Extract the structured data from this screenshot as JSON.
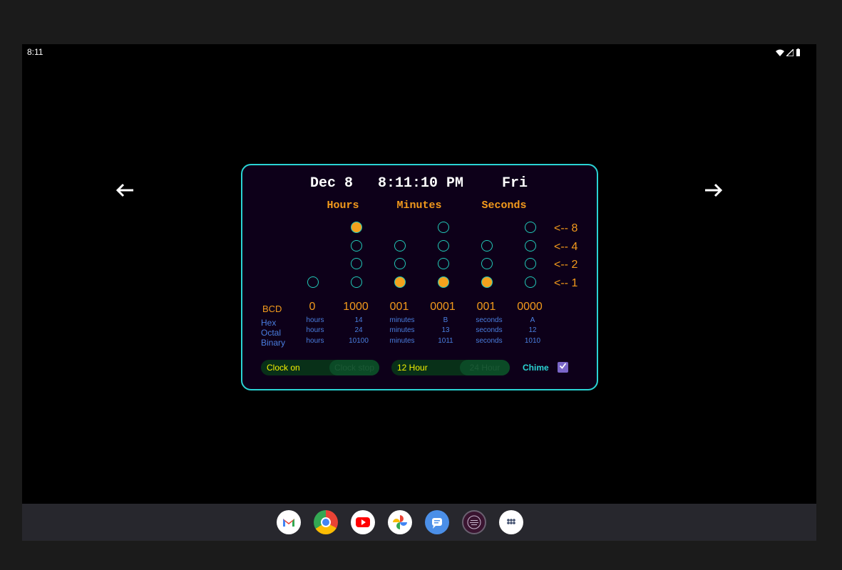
{
  "status": {
    "time": "8:11"
  },
  "nav": {
    "back_icon": "arrow-left-icon",
    "forward_icon": "arrow-right-icon"
  },
  "clock": {
    "date": "Dec 8",
    "time": "8:11:10 PM",
    "weekday": "Fri",
    "headers": {
      "hours": "Hours",
      "minutes": "Minutes",
      "seconds": "Seconds"
    },
    "weights": [
      "<-- 8",
      "<-- 4",
      "<-- 2",
      "<-- 1"
    ],
    "bcd_label": "BCD",
    "bcd_values": [
      "0",
      "1000",
      "001",
      "0001",
      "001",
      "0000"
    ],
    "columns": [
      {
        "bits": [
          1
        ],
        "lit": [
          false
        ]
      },
      {
        "bits": [
          8,
          4,
          2,
          1
        ],
        "lit": [
          true,
          false,
          false,
          false
        ]
      },
      {
        "bits": [
          4,
          2,
          1
        ],
        "lit": [
          false,
          false,
          true
        ]
      },
      {
        "bits": [
          8,
          4,
          2,
          1
        ],
        "lit": [
          false,
          false,
          false,
          true
        ]
      },
      {
        "bits": [
          4,
          2,
          1
        ],
        "lit": [
          false,
          false,
          true
        ]
      },
      {
        "bits": [
          8,
          4,
          2,
          1
        ],
        "lit": [
          false,
          false,
          false,
          false
        ]
      }
    ],
    "conversions": {
      "labels": [
        "Hex",
        "Octal",
        "Binary"
      ],
      "hours_unit": "hours",
      "minutes_unit": "minutes",
      "seconds_unit": "seconds",
      "hours": [
        "14",
        "24",
        "10100"
      ],
      "minutes": [
        "B",
        "13",
        "1011"
      ],
      "seconds": [
        "A",
        "12",
        "1010"
      ]
    },
    "controls": {
      "clock_on": "Clock on",
      "clock_stop": "Clock stop",
      "hour12": "12 Hour",
      "hour24": "24 Hour",
      "chime": "Chime",
      "chime_checked": true
    },
    "colors": {
      "accent": "#2ad4d4",
      "lit": "#f3a21d",
      "text_orange": "#f39a1c",
      "text_blue": "#4a7ee0"
    }
  },
  "taskbar": {
    "apps": [
      "gmail-icon",
      "chrome-icon",
      "youtube-icon",
      "photos-icon",
      "messages-icon",
      "clock-app-icon",
      "app-drawer-icon"
    ]
  }
}
